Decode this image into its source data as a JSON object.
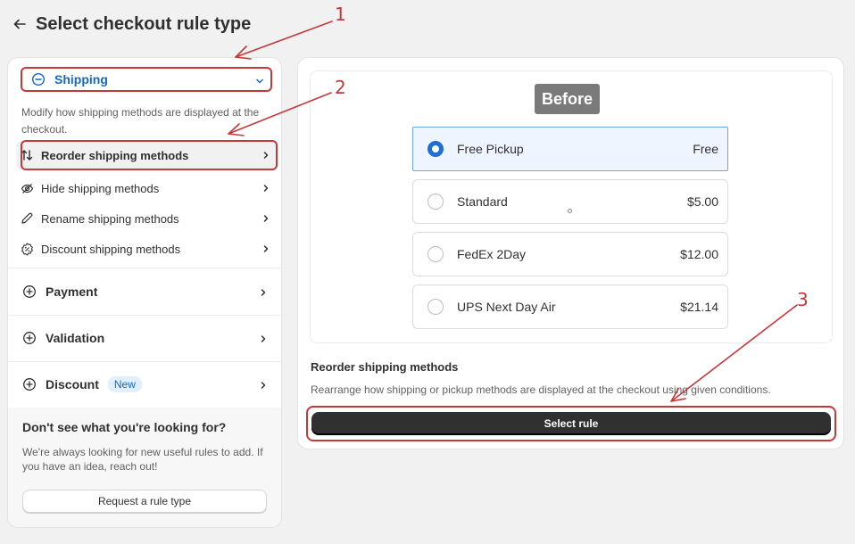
{
  "header": {
    "title": "Select checkout rule type"
  },
  "annotations": [
    "1",
    "2",
    "3"
  ],
  "sidebar": {
    "shipping": {
      "label": "Shipping",
      "description": "Modify how shipping methods are displayed at the checkout.",
      "items": [
        {
          "label": "Reorder shipping methods",
          "icon": "reorder-icon"
        },
        {
          "label": "Hide shipping methods",
          "icon": "eye-off-icon"
        },
        {
          "label": "Rename shipping methods",
          "icon": "pencil-icon"
        },
        {
          "label": "Discount shipping methods",
          "icon": "discount-icon"
        }
      ]
    },
    "sections": [
      {
        "label": "Payment"
      },
      {
        "label": "Validation"
      },
      {
        "label": "Discount",
        "badge": "New"
      }
    ],
    "footer": {
      "title": "Don't see what you're looking for?",
      "text": "We're always looking for new useful rules to add. If you have an idea, reach out!",
      "button": "Request a rule type"
    }
  },
  "preview": {
    "badge": "Before",
    "options": [
      {
        "name": "Free Pickup",
        "price": "Free",
        "selected": true
      },
      {
        "name": "Standard",
        "price": "$5.00",
        "selected": false
      },
      {
        "name": "FedEx 2Day",
        "price": "$12.00",
        "selected": false
      },
      {
        "name": "UPS Next Day Air",
        "price": "$21.14",
        "selected": false
      }
    ]
  },
  "detail": {
    "title": "Reorder shipping methods",
    "description": "Rearrange how shipping or pickup methods are displayed at the checkout using given conditions.",
    "button": "Select rule"
  },
  "colors": {
    "annotation": "#c6373a",
    "link": "#1567c0",
    "radio_on": "#1d6fd6"
  }
}
